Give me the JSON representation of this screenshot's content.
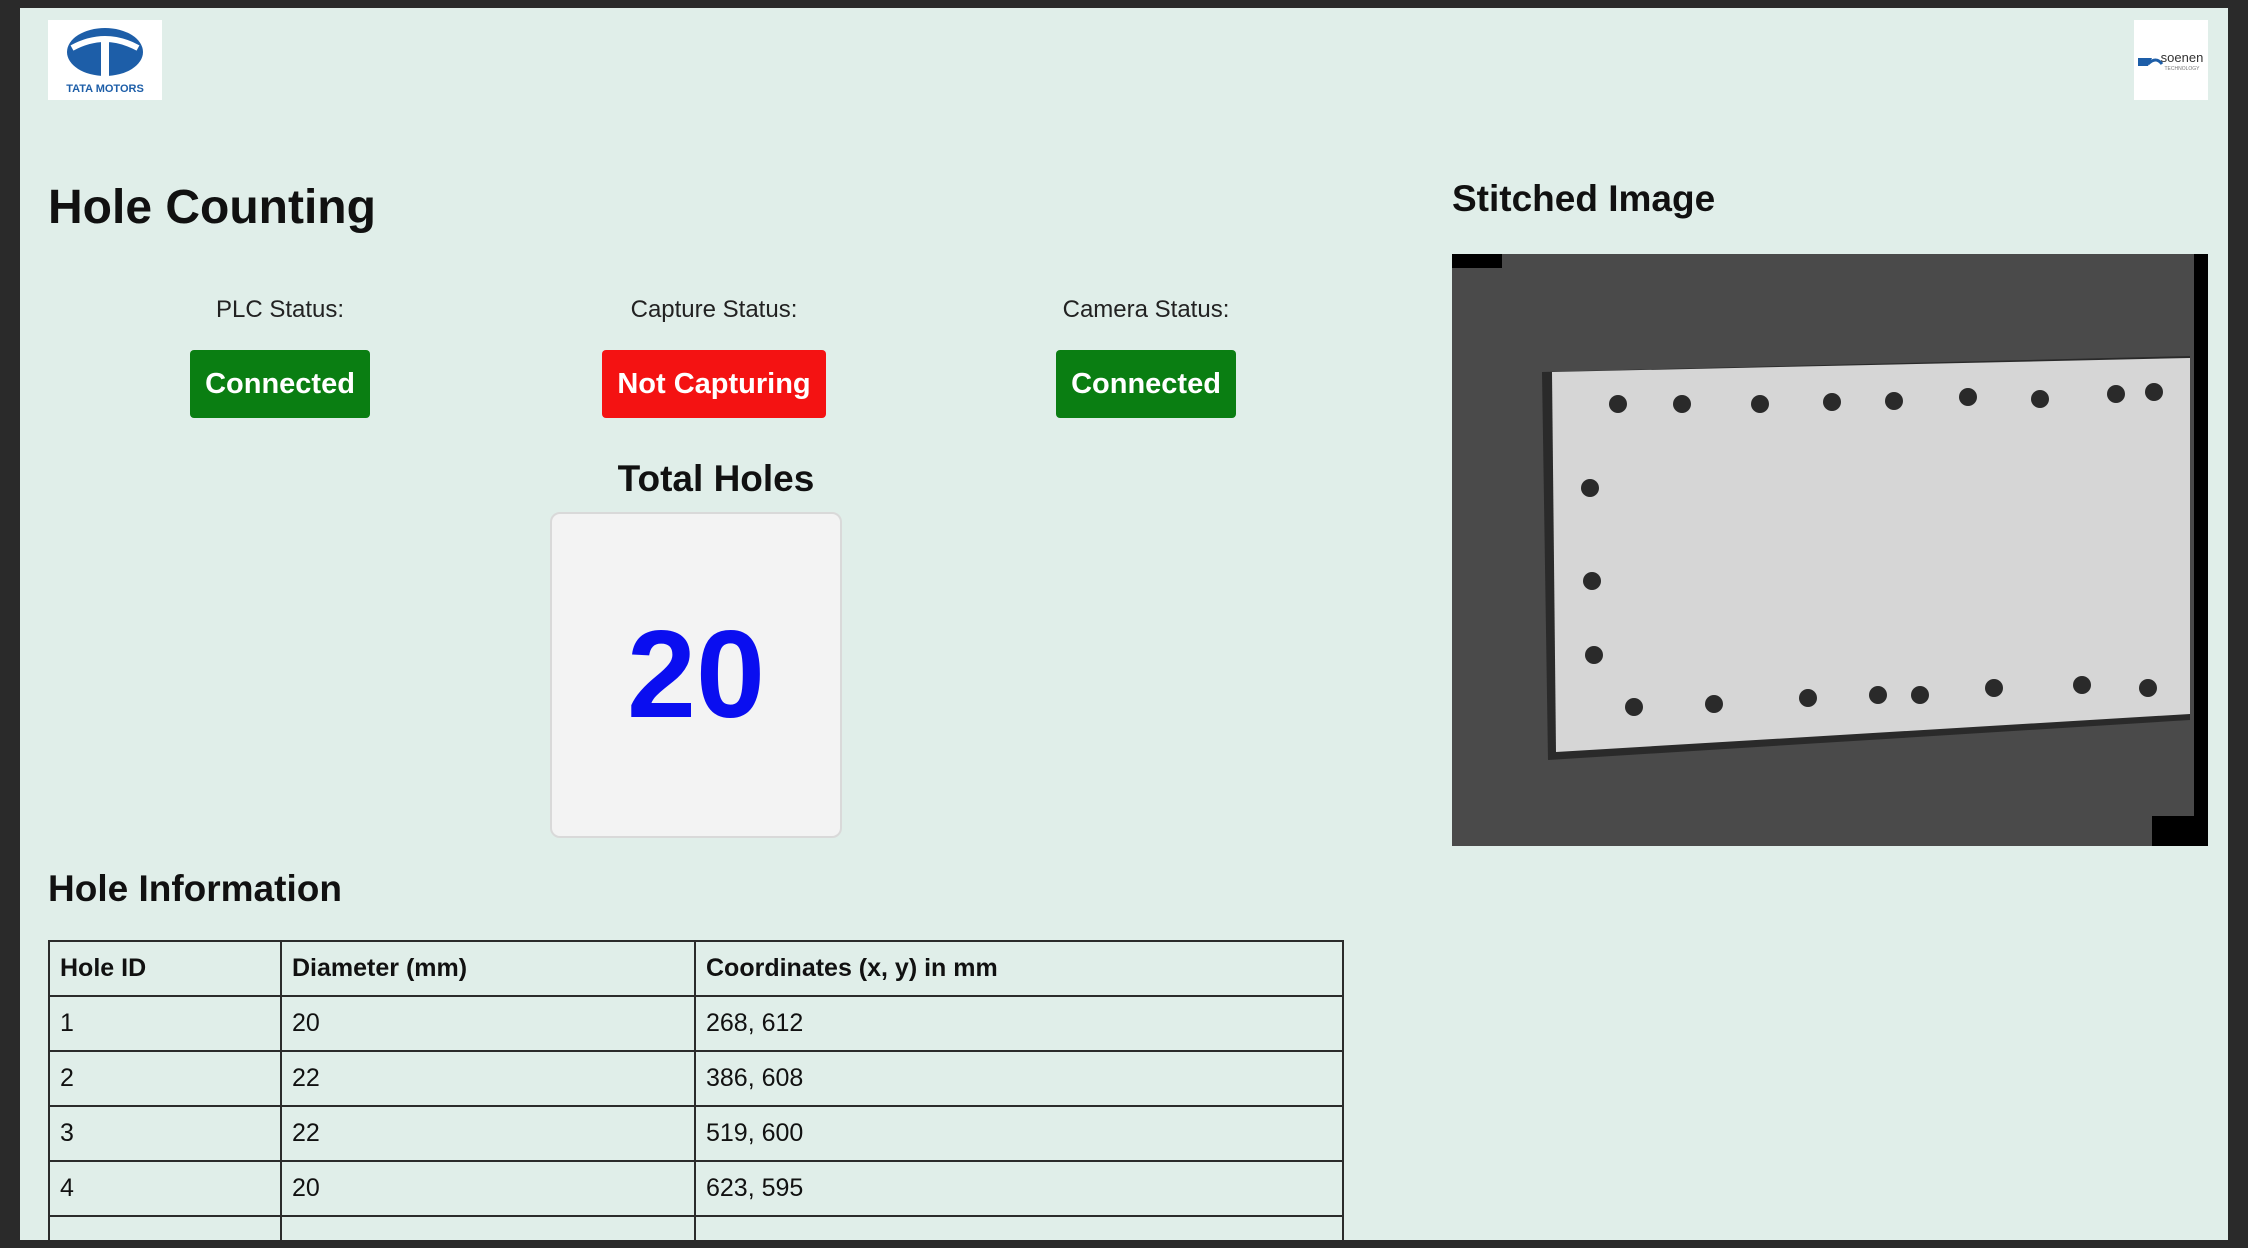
{
  "header": {
    "left_logo": {
      "icon": "tata-motors-logo-icon",
      "text": "TATA MOTORS"
    },
    "right_logo": {
      "icon": "soenen-logo-icon",
      "text": "soenen",
      "subtext": "TECHNOLOGY"
    }
  },
  "page": {
    "title": "Hole Counting"
  },
  "status": {
    "plc": {
      "label": "PLC Status:",
      "value": "Connected",
      "color": "#0a7e12"
    },
    "capture": {
      "label": "Capture Status:",
      "value": "Not Capturing",
      "color": "#f41212"
    },
    "camera": {
      "label": "Camera Status:",
      "value": "Connected",
      "color": "#0a7e12"
    }
  },
  "total": {
    "label": "Total Holes",
    "value": "20",
    "value_color": "#0a0ef0"
  },
  "holes": {
    "title": "Hole Information",
    "columns": [
      "Hole ID",
      "Diameter (mm)",
      "Coordinates (x, y) in mm"
    ],
    "rows": [
      [
        "1",
        "20",
        "268, 612"
      ],
      [
        "2",
        "22",
        "386, 608"
      ],
      [
        "3",
        "22",
        "519, 600"
      ],
      [
        "4",
        "20",
        "623, 595"
      ]
    ]
  },
  "stitched": {
    "title": "Stitched Image",
    "image": "grayscale-stitched-panel-photo"
  },
  "colors": {
    "background": "#e0eee9",
    "accent_blue": "#0a0ef0",
    "brand_blue": "#1d5ea8"
  }
}
